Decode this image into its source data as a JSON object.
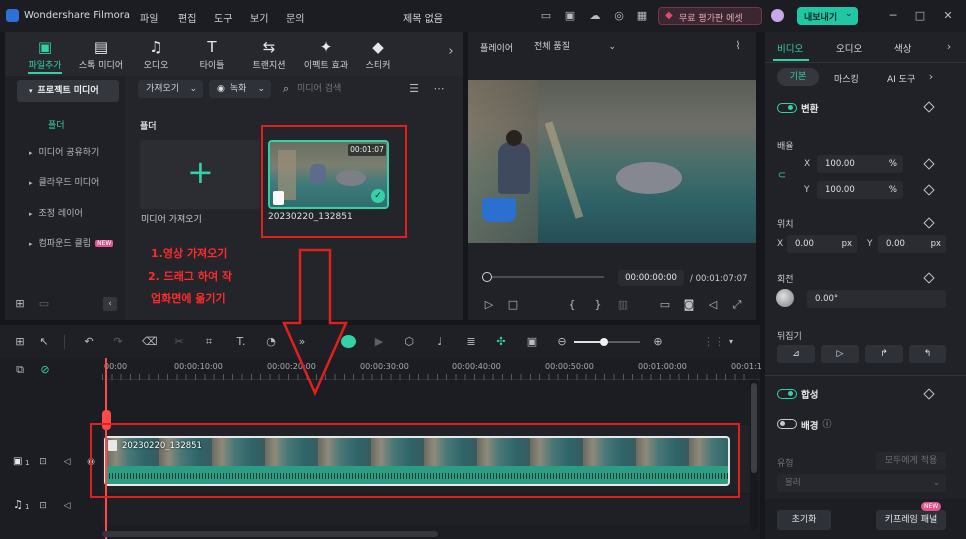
{
  "app": {
    "title": "Wondershare Filmora",
    "doc_title": "제목 없음"
  },
  "menu": [
    "파일",
    "편집",
    "도구",
    "보기",
    "문의"
  ],
  "header": {
    "trial_label": "무료 평가판 에셋",
    "export_label": "내보내기"
  },
  "toolbar": {
    "items": [
      "파일추가",
      "스톡 미디어",
      "오디오",
      "타이틀",
      "트랜지션",
      "이펙트 효과",
      "스티커"
    ]
  },
  "media": {
    "sidebar": [
      "프로젝트 미디어",
      "폴더",
      "미디어 공유하기",
      "클라우드 미디어",
      "조정 레이어",
      "컴파운드 클립"
    ],
    "compound_badge": "NEW",
    "import_label": "가져오기",
    "record_label": "녹화",
    "search_placeholder": "미디어 검색",
    "folder_label": "폴더",
    "import_tile_label": "미디어 가져오기",
    "clip_name": "20230220_132851",
    "clip_duration": "00:01:07"
  },
  "annotation": {
    "line1": "1.영상 가져오기",
    "line2": "2. 드래그 하여 작",
    "line3": "업화면에 옮기기"
  },
  "player": {
    "label": "플레이어",
    "quality": "전체 품질",
    "current_time": "00:00:00:00",
    "total_time": "/ 00:01:07:07"
  },
  "properties": {
    "tabs": [
      "비디오",
      "오디오",
      "색상"
    ],
    "subtabs": [
      "기본",
      "마스킹",
      "AI 도구"
    ],
    "transform_label": "변환",
    "scale_label": "배율",
    "scale_x": "100.00",
    "scale_y": "100.00",
    "percent": "%",
    "position_label": "위치",
    "pos_x": "0.00",
    "pos_y": "0.00",
    "px": "px",
    "rotation_label": "회전",
    "rotation_value": "0.00°",
    "flip_label": "뒤집기",
    "composite_label": "합성",
    "background_label": "배경",
    "type_label": "유형",
    "apply_all_label": "모두에게 적용",
    "blur_label": "블러",
    "reset_label": "초기화",
    "keyframe_label": "키프레임 패널",
    "keyframe_badge": "NEW",
    "x_label": "X",
    "y_label": "Y"
  },
  "timeline": {
    "ruler": [
      "00:00",
      "00:00:10:00",
      "00:00:20:00",
      "00:00:30:00",
      "00:00:40:00",
      "00:00:50:00",
      "00:01:00:00",
      "00:01:1"
    ],
    "clip_label": "20230220_132851",
    "video_track": "1",
    "audio_track": "1"
  },
  "colors": {
    "accent": "#34d0a8",
    "annotation": "#e0201e",
    "trial": "#e24b6d"
  }
}
